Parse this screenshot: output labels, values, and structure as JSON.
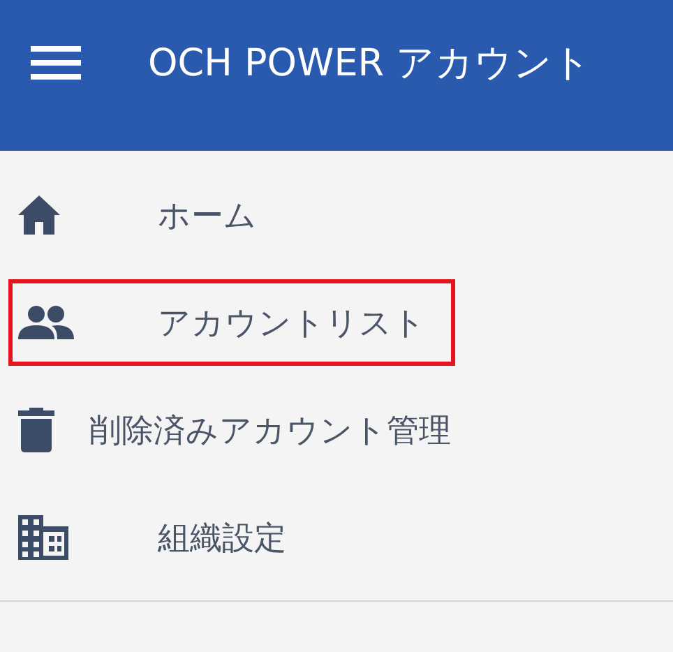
{
  "header": {
    "title": "OCH POWER アカウント"
  },
  "menu": [
    {
      "label": "ホーム",
      "highlighted": false
    },
    {
      "label": "アカウントリスト",
      "highlighted": true
    },
    {
      "label": "削除済みアカウント管理",
      "highlighted": false
    },
    {
      "label": "組織設定",
      "highlighted": false
    }
  ]
}
